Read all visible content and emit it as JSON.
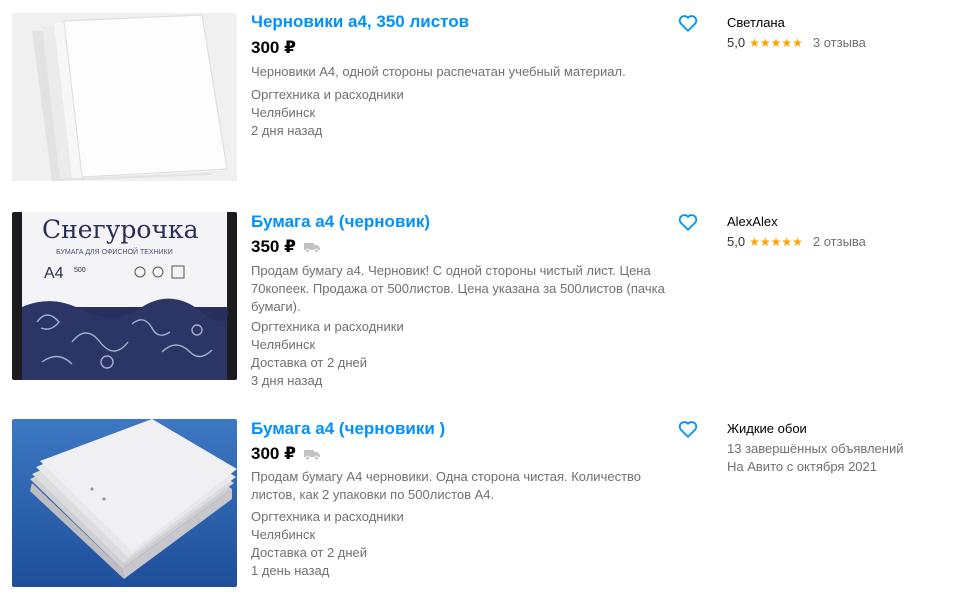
{
  "listings": [
    {
      "title": "Черновики а4, 350 листов",
      "price": "300 ₽",
      "has_delivery_icon": false,
      "description": "Черновики А4, одной стороны распечатан учебный материал.",
      "category": "Оргтехника и расходники",
      "city": "Челябинск",
      "delivery": "",
      "date": "2 дня назад",
      "seller": {
        "name": "Светлана",
        "rating": "5,0",
        "stars": "★★★★★",
        "reviews": "3 отзыва"
      }
    },
    {
      "title": "Бумага а4 (черновик)",
      "price": "350 ₽",
      "has_delivery_icon": true,
      "description": "Продам бумагу а4. Черновик! С одной стороны чистый лист. Цена 70копеек. Продажа от 500листов. Цена указана за 500листов (пачка бумаги).",
      "category": "Оргтехника и расходники",
      "city": "Челябинск",
      "delivery": "Доставка от 2 дней",
      "date": "3 дня назад",
      "image_text": {
        "brand": "Снегурочка",
        "subtitle": "БУМАГА ДЛЯ ОФИСНОЙ ТЕХНИКИ",
        "format": "А4",
        "count": "500"
      },
      "seller": {
        "name": "AlexAlex",
        "rating": "5,0",
        "stars": "★★★★★",
        "reviews": "2 отзыва"
      }
    },
    {
      "title": "Бумага а4 (черновики )",
      "price": "300 ₽",
      "has_delivery_icon": true,
      "description": "Продам бумагу А4 черновики. Одна сторона чистая. Количество листов, как 2 упаковки по 500листов А4.",
      "category": "Оргтехника и расходники",
      "city": "Челябинск",
      "delivery": "Доставка от 2 дней",
      "date": "1 день назад",
      "seller": {
        "name": "Жидкие обои",
        "completed": "13 завершённых объявлений",
        "since": "На Авито с октября 2021"
      }
    }
  ],
  "colors": {
    "link": "#0091ff",
    "muted": "#707070",
    "star": "#ffa200",
    "heart": "#0091ff"
  }
}
